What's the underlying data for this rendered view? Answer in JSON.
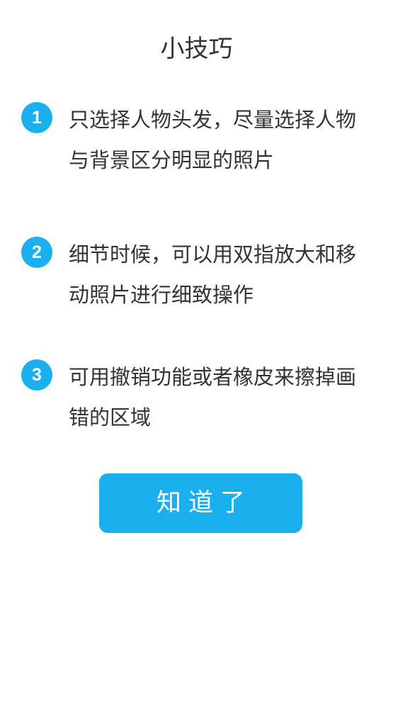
{
  "dialog": {
    "title": "小技巧",
    "tips": [
      {
        "number": "1",
        "text": "只选择人物头发，尽量选择人物与背景区分明显的照片"
      },
      {
        "number": "2",
        "text": "细节时候，可以用双指放大和移动照片进行细致操作"
      },
      {
        "number": "3",
        "text": "可用撤销功能或者橡皮来擦掉画错的区域"
      }
    ],
    "confirm_label": "知道了"
  },
  "colors": {
    "accent": "#1ab0f0",
    "text": "#333333",
    "background": "#ffffff"
  }
}
